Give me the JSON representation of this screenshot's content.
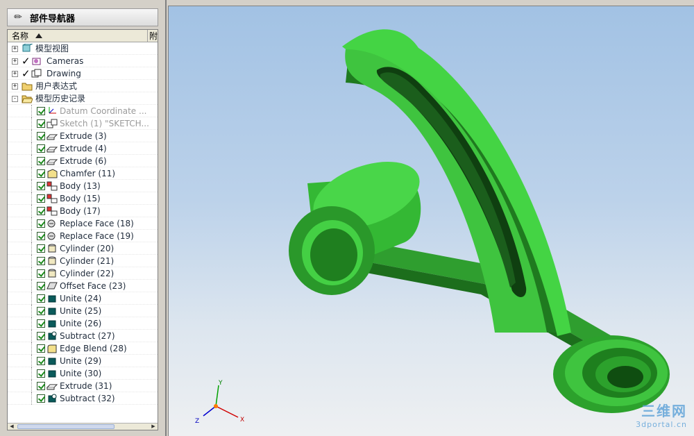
{
  "navigator": {
    "title": "部件导航器",
    "columns": [
      "名称",
      "附"
    ],
    "items": [
      {
        "label": "模型视图",
        "level": 0,
        "expander": "+",
        "icon": "model-views-icon",
        "checked": false,
        "tick": false,
        "dim": false
      },
      {
        "label": "Cameras",
        "level": 0,
        "expander": "+",
        "icon": "camera-icon",
        "checked": false,
        "tick": true,
        "dim": false
      },
      {
        "label": "Drawing",
        "level": 0,
        "expander": "+",
        "icon": "drawing-icon",
        "checked": false,
        "tick": true,
        "dim": false
      },
      {
        "label": "用户表达式",
        "level": 0,
        "expander": "+",
        "icon": "folder-icon",
        "checked": false,
        "tick": false,
        "dim": false
      },
      {
        "label": "模型历史记录",
        "level": 0,
        "expander": "-",
        "icon": "folder-open-icon",
        "checked": false,
        "tick": false,
        "dim": false
      },
      {
        "label": "Datum Coordinate ...",
        "level": 1,
        "icon": "datum-csys-icon",
        "checked": true,
        "dim": true
      },
      {
        "label": "Sketch (1) \"SKETCH...",
        "level": 1,
        "icon": "sketch-icon",
        "checked": true,
        "dim": true
      },
      {
        "label": "Extrude (3)",
        "level": 1,
        "icon": "extrude-icon",
        "checked": true,
        "dim": false
      },
      {
        "label": "Extrude (4)",
        "level": 1,
        "icon": "extrude-icon",
        "checked": true,
        "dim": false
      },
      {
        "label": "Extrude (6)",
        "level": 1,
        "icon": "extrude-icon",
        "checked": true,
        "dim": false
      },
      {
        "label": "Chamfer (11)",
        "level": 1,
        "icon": "chamfer-icon",
        "checked": true,
        "dim": false
      },
      {
        "label": "Body (13)",
        "level": 1,
        "icon": "body-icon",
        "checked": true,
        "dim": false
      },
      {
        "label": "Body (15)",
        "level": 1,
        "icon": "body-icon",
        "checked": true,
        "dim": false
      },
      {
        "label": "Body (17)",
        "level": 1,
        "icon": "body-icon",
        "checked": true,
        "dim": false
      },
      {
        "label": "Replace Face (18)",
        "level": 1,
        "icon": "replace-face-icon",
        "checked": true,
        "dim": false
      },
      {
        "label": "Replace Face (19)",
        "level": 1,
        "icon": "replace-face-icon",
        "checked": true,
        "dim": false
      },
      {
        "label": "Cylinder (20)",
        "level": 1,
        "icon": "cylinder-icon",
        "checked": true,
        "dim": false
      },
      {
        "label": "Cylinder (21)",
        "level": 1,
        "icon": "cylinder-icon",
        "checked": true,
        "dim": false
      },
      {
        "label": "Cylinder (22)",
        "level": 1,
        "icon": "cylinder-icon",
        "checked": true,
        "dim": false
      },
      {
        "label": "Offset Face (23)",
        "level": 1,
        "icon": "offset-face-icon",
        "checked": true,
        "dim": false
      },
      {
        "label": "Unite (24)",
        "level": 1,
        "icon": "unite-icon",
        "checked": true,
        "dim": false
      },
      {
        "label": "Unite (25)",
        "level": 1,
        "icon": "unite-icon",
        "checked": true,
        "dim": false
      },
      {
        "label": "Unite (26)",
        "level": 1,
        "icon": "unite-icon",
        "checked": true,
        "dim": false
      },
      {
        "label": "Subtract (27)",
        "level": 1,
        "icon": "subtract-icon",
        "checked": true,
        "dim": false
      },
      {
        "label": "Edge Blend (28)",
        "level": 1,
        "icon": "edge-blend-icon",
        "checked": true,
        "dim": false
      },
      {
        "label": "Unite (29)",
        "level": 1,
        "icon": "unite-icon",
        "checked": true,
        "dim": false
      },
      {
        "label": "Unite (30)",
        "level": 1,
        "icon": "unite-icon",
        "checked": true,
        "dim": false
      },
      {
        "label": "Extrude (31)",
        "level": 1,
        "icon": "extrude-icon",
        "checked": true,
        "dim": false
      },
      {
        "label": "Subtract (32)",
        "level": 1,
        "icon": "subtract-icon",
        "checked": true,
        "dim": false
      }
    ]
  },
  "viewport": {
    "axis_x": "X",
    "axis_y": "Y",
    "axis_z": "Z",
    "watermark_logo": "三维网",
    "watermark_url": "3dportal.cn",
    "model_color": "#3fc43f",
    "background_top": "#a2c2e4",
    "background_bottom": "#eef0f2"
  }
}
